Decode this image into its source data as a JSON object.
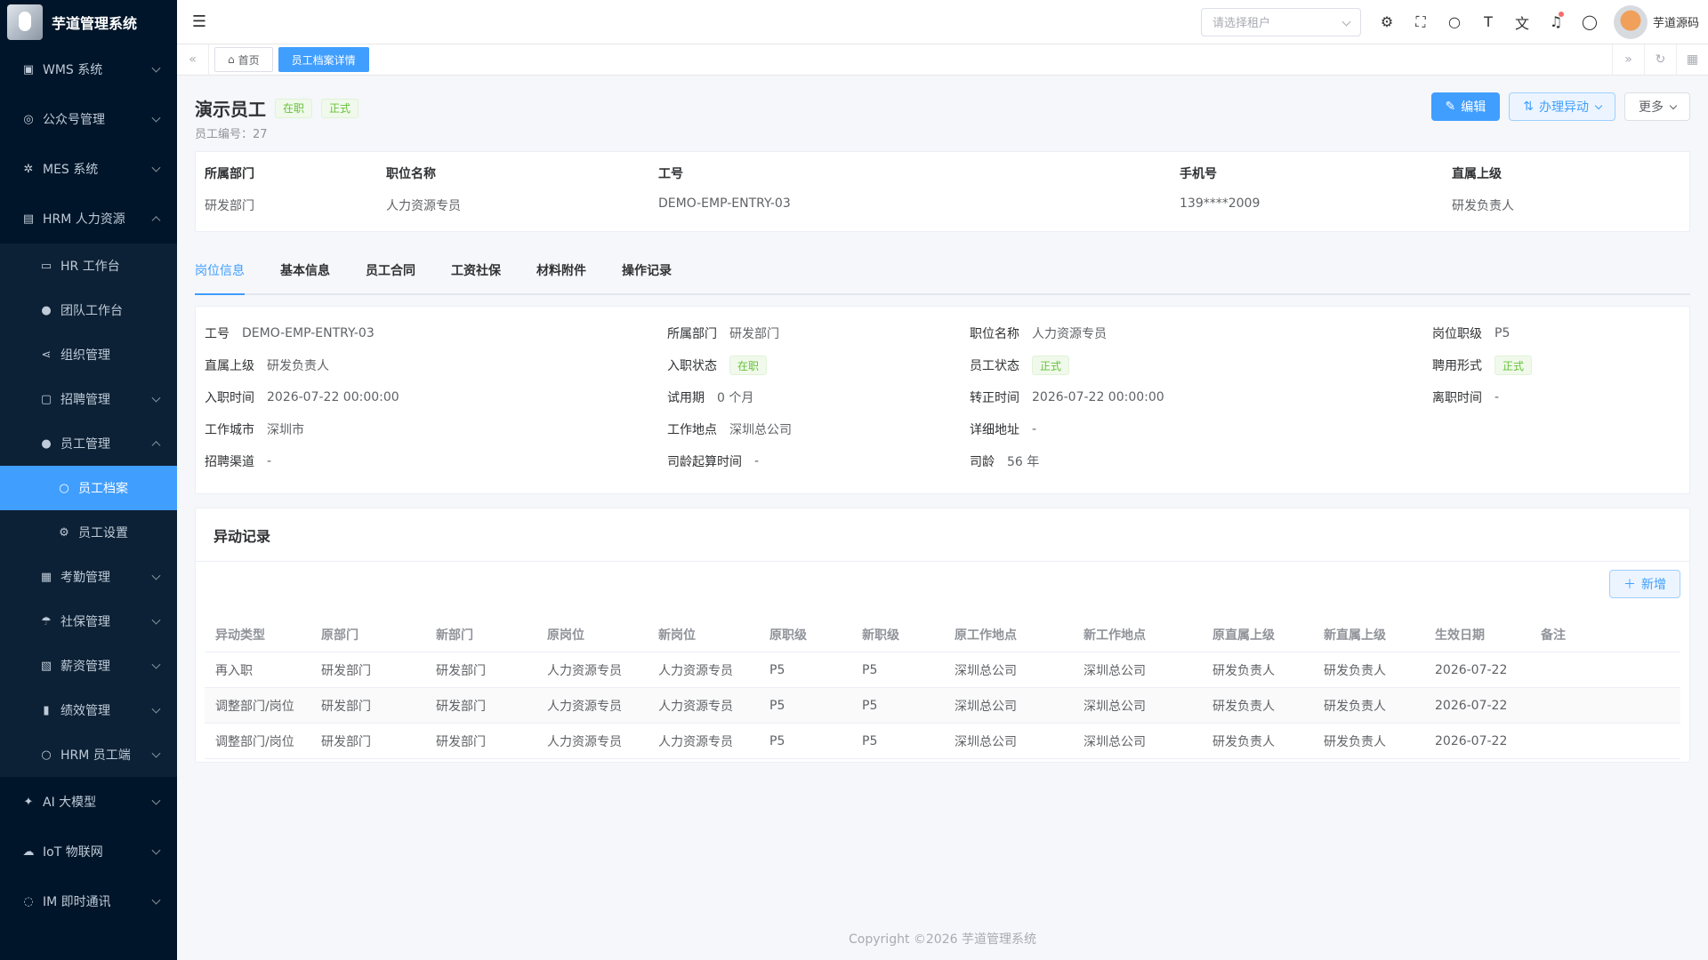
{
  "app": {
    "title": "芋道管理系统"
  },
  "sidebar": {
    "items": [
      {
        "label": "WMS 系统",
        "icon": "box-icon"
      },
      {
        "label": "公众号管理",
        "icon": "compass-icon"
      },
      {
        "label": "MES 系统",
        "icon": "cog-icon"
      },
      {
        "label": "HRM 人力资源",
        "icon": "building-icon"
      },
      {
        "label": "AI 大模型",
        "icon": "ai-icon"
      },
      {
        "label": "IoT 物联网",
        "icon": "cloud-icon"
      },
      {
        "label": "IM 即时通讯",
        "icon": "chat-icon"
      }
    ],
    "hrm_children": [
      {
        "label": "HR 工作台"
      },
      {
        "label": "团队工作台"
      },
      {
        "label": "组织管理"
      },
      {
        "label": "招聘管理"
      },
      {
        "label": "员工管理"
      },
      {
        "label": "考勤管理"
      },
      {
        "label": "社保管理"
      },
      {
        "label": "薪资管理"
      },
      {
        "label": "绩效管理"
      },
      {
        "label": "HRM 员工端"
      }
    ],
    "employee_children": [
      {
        "label": "员工档案"
      },
      {
        "label": "员工设置"
      }
    ]
  },
  "topbar": {
    "tenant_placeholder": "请选择租户",
    "user_name": "芋道源码"
  },
  "tags": {
    "home": "首页",
    "current": "员工档案详情"
  },
  "employee": {
    "name": "演示员工",
    "badge_status": "在职",
    "badge_type": "正式",
    "no_label": "员工编号：27"
  },
  "actions": {
    "edit": "编辑",
    "transfer": "办理异动",
    "more": "更多"
  },
  "summary": [
    {
      "label": "所属部门",
      "value": "研发部门"
    },
    {
      "label": "职位名称",
      "value": "人力资源专员"
    },
    {
      "label": "工号",
      "value": "DEMO-EMP-ENTRY-03"
    },
    {
      "label": "手机号",
      "value": "139****2009"
    },
    {
      "label": "直属上级",
      "value": "研发负责人"
    }
  ],
  "tabs": [
    "岗位信息",
    "基本信息",
    "员工合同",
    "工资社保",
    "材料附件",
    "操作记录"
  ],
  "info": {
    "r1": [
      {
        "k": "工号",
        "v": "DEMO-EMP-ENTRY-03"
      },
      {
        "k": "所属部门",
        "v": "研发部门"
      },
      {
        "k": "职位名称",
        "v": "人力资源专员"
      },
      {
        "k": "岗位职级",
        "v": "P5"
      }
    ],
    "r2": [
      {
        "k": "直属上级",
        "v": "研发负责人"
      },
      {
        "k": "入职状态",
        "v": "在职"
      },
      {
        "k": "员工状态",
        "v": "正式"
      },
      {
        "k": "聘用形式",
        "v": "正式"
      }
    ],
    "r3": [
      {
        "k": "入职时间",
        "v": "2026-07-22 00:00:00"
      },
      {
        "k": "试用期",
        "v": "0 个月"
      },
      {
        "k": "转正时间",
        "v": "2026-07-22 00:00:00"
      },
      {
        "k": "离职时间",
        "v": "-"
      }
    ],
    "r4": [
      {
        "k": "工作城市",
        "v": "深圳市"
      },
      {
        "k": "工作地点",
        "v": "深圳总公司"
      },
      {
        "k": "详细地址",
        "v": "-"
      }
    ],
    "r5": [
      {
        "k": "招聘渠道",
        "v": "-"
      },
      {
        "k": "司龄起算时间",
        "v": "-"
      },
      {
        "k": "司龄",
        "v": "56 年"
      }
    ]
  },
  "records": {
    "title": "异动记录",
    "add_label": "新增",
    "columns": [
      "异动类型",
      "原部门",
      "新部门",
      "原岗位",
      "新岗位",
      "原职级",
      "新职级",
      "原工作地点",
      "新工作地点",
      "原直属上级",
      "新直属上级",
      "生效日期",
      "备注"
    ],
    "rows": [
      [
        "再入职",
        "研发部门",
        "研发部门",
        "人力资源专员",
        "人力资源专员",
        "P5",
        "P5",
        "深圳总公司",
        "深圳总公司",
        "研发负责人",
        "研发负责人",
        "2026-07-22",
        ""
      ],
      [
        "调整部门/岗位",
        "研发部门",
        "研发部门",
        "人力资源专员",
        "人力资源专员",
        "P5",
        "P5",
        "深圳总公司",
        "深圳总公司",
        "研发负责人",
        "研发负责人",
        "2026-07-22",
        ""
      ],
      [
        "调整部门/岗位",
        "研发部门",
        "研发部门",
        "人力资源专员",
        "人力资源专员",
        "P5",
        "P5",
        "深圳总公司",
        "深圳总公司",
        "研发负责人",
        "研发负责人",
        "2026-07-22",
        ""
      ]
    ]
  },
  "footer": {
    "text": "Copyright ©2026 芋道管理系统"
  }
}
